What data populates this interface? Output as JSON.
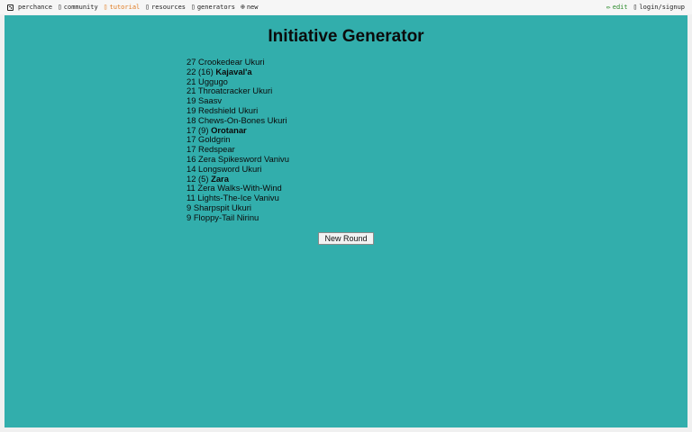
{
  "nav": {
    "left": [
      {
        "key": "perchance",
        "label": "perchance",
        "icon": "die-icon"
      },
      {
        "key": "community",
        "label": "community",
        "icon": "chat-icon"
      },
      {
        "key": "tutorial",
        "label": "tutorial",
        "icon": "book-icon"
      },
      {
        "key": "resources",
        "label": "resources",
        "icon": "box-icon"
      },
      {
        "key": "generators",
        "label": "generators",
        "icon": "gear-icon"
      },
      {
        "key": "new",
        "label": "new",
        "icon": "plus-circle-icon"
      }
    ],
    "right": [
      {
        "key": "edit",
        "label": "edit",
        "icon": "pencil-icon"
      },
      {
        "key": "login",
        "label": "login/signup",
        "icon": "user-icon"
      }
    ]
  },
  "page": {
    "title": "Initiative Generator",
    "button_label": "New Round"
  },
  "initiative": [
    {
      "roll": "27",
      "name": "Crookedear Ukuri",
      "bold": false
    },
    {
      "roll": "22 (16)",
      "name": "Kajaval'a",
      "bold": true
    },
    {
      "roll": "21",
      "name": "Uggugo",
      "bold": false
    },
    {
      "roll": "21",
      "name": "Throatcracker Ukuri",
      "bold": false
    },
    {
      "roll": "19",
      "name": "Saasv",
      "bold": false
    },
    {
      "roll": "19",
      "name": "Redshield Ukuri",
      "bold": false
    },
    {
      "roll": "18",
      "name": "Chews-On-Bones Ukuri",
      "bold": false
    },
    {
      "roll": "17 (9)",
      "name": "Orotanar",
      "bold": true
    },
    {
      "roll": "17",
      "name": "Goldgrin",
      "bold": false
    },
    {
      "roll": "17",
      "name": "Redspear",
      "bold": false
    },
    {
      "roll": "16",
      "name": "Zera Spikesword Vanivu",
      "bold": false
    },
    {
      "roll": "14",
      "name": "Longsword Ukuri",
      "bold": false
    },
    {
      "roll": "12 (5)",
      "name": "Zara",
      "bold": true
    },
    {
      "roll": "11",
      "name": "Zera Walks-With-Wind",
      "bold": false
    },
    {
      "roll": "11",
      "name": "Lights-The-Ice Vanivu",
      "bold": false
    },
    {
      "roll": "9",
      "name": "Sharpspit Ukuri",
      "bold": false
    },
    {
      "roll": "9",
      "name": "Floppy-Tail Nirinu",
      "bold": false
    }
  ]
}
